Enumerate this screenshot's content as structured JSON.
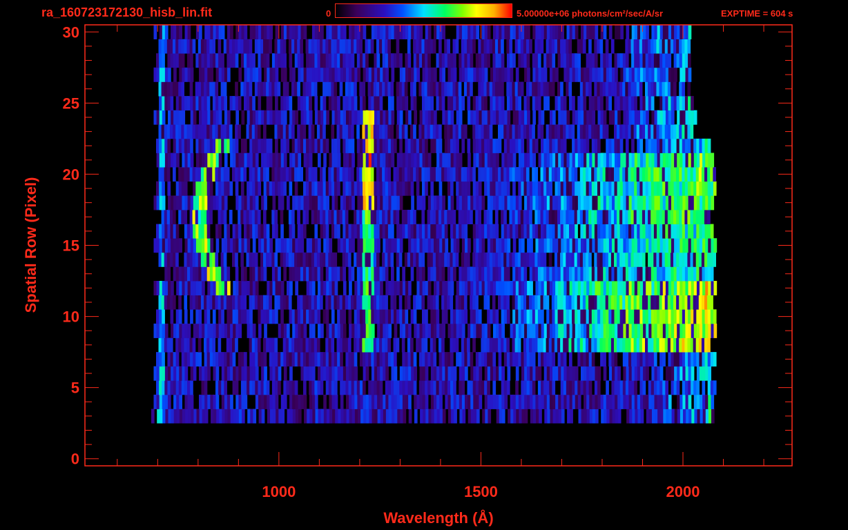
{
  "header": {
    "title": "ra_160723172130_hisb_lin.fit",
    "colorbar_min": "0",
    "colorbar_max_label": "5.00000e+06 photons/cm²/sec/A/sr",
    "exptime": "EXPTIME = 604 s"
  },
  "colors": {
    "axis": "#ff2a1a",
    "background": "#000000",
    "colormap": [
      "#000000",
      "#3a005a",
      "#2a10c0",
      "#0050ff",
      "#00e0ff",
      "#00ff60",
      "#80ff00",
      "#ffff00",
      "#ffb000",
      "#ff0000"
    ]
  },
  "chart_data": {
    "type": "heatmap",
    "title": "ra_160723172130_hisb_lin.fit",
    "xlabel": "Wavelength (Å)",
    "ylabel": "Spatial Row (Pixel)",
    "xlim": [
      520,
      2270
    ],
    "ylim": [
      -0.5,
      30.5
    ],
    "x_ticks": [
      "1000",
      "1500",
      "2000"
    ],
    "y_ticks": [
      "0",
      "5",
      "10",
      "15",
      "20",
      "25",
      "30"
    ],
    "colorbar_range": [
      0,
      5000000
    ],
    "colorbar_units": "photons/cm²/sec/A/sr",
    "exptime_s": 604,
    "detector_extent": {
      "x": [
        690,
        2080
      ],
      "rows": [
        3,
        30
      ]
    },
    "features": [
      {
        "name": "line_~1216",
        "wavelength": 1216,
        "rows": [
          8,
          24
        ],
        "level": 0.55
      },
      {
        "name": "curved_feature",
        "wavelength_range": [
          800,
          900
        ],
        "rows": [
          12,
          22
        ],
        "level": 0.45
      },
      {
        "name": "continuum_red",
        "wavelength_range": [
          1650,
          2070
        ],
        "rows": [
          8,
          21
        ],
        "level": 0.6
      }
    ]
  }
}
